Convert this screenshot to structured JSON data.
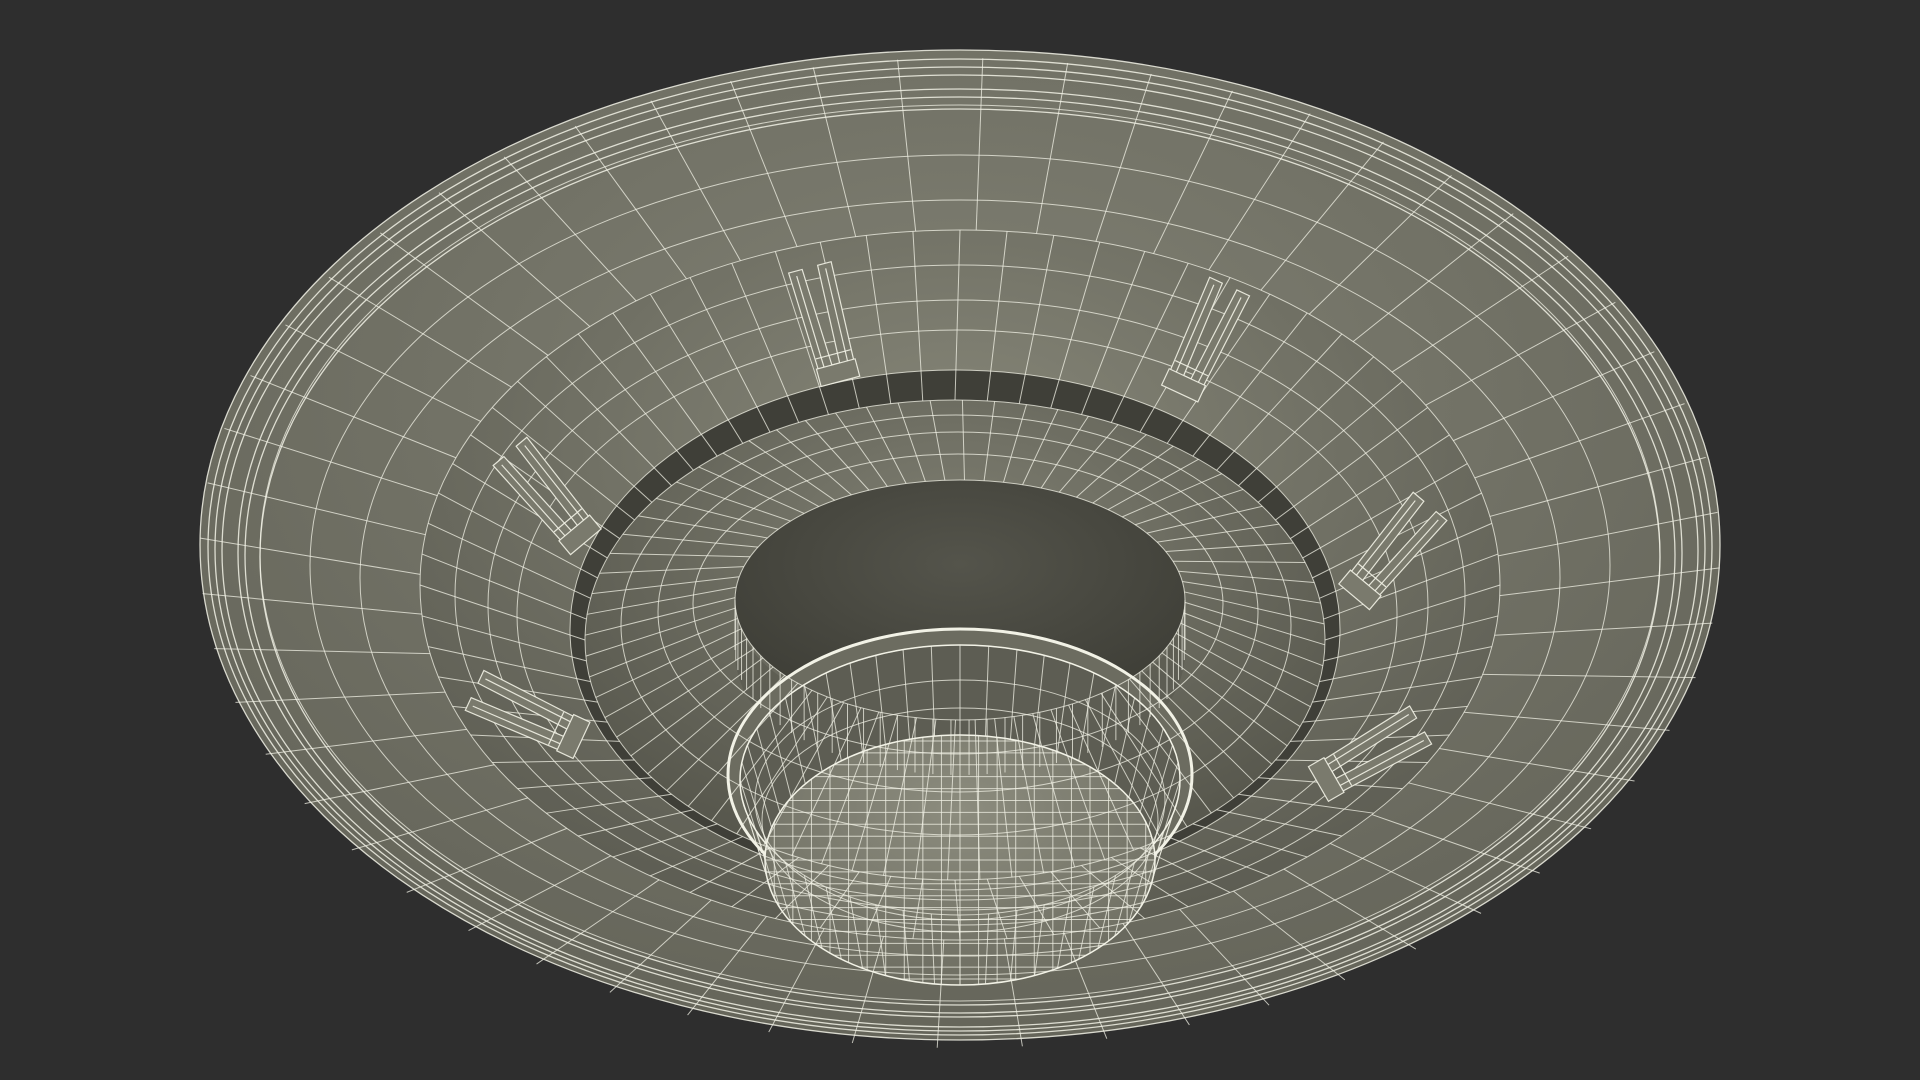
{
  "scene": {
    "subject_icon": "wireframe-saucer-icon",
    "colors": {
      "background": "#2e2e2e",
      "surface_light": "#878779",
      "surface_mid": "#707064",
      "surface_dark": "#56564c",
      "cavity": "#4a4a42",
      "wire": "#f2f2e6"
    }
  }
}
